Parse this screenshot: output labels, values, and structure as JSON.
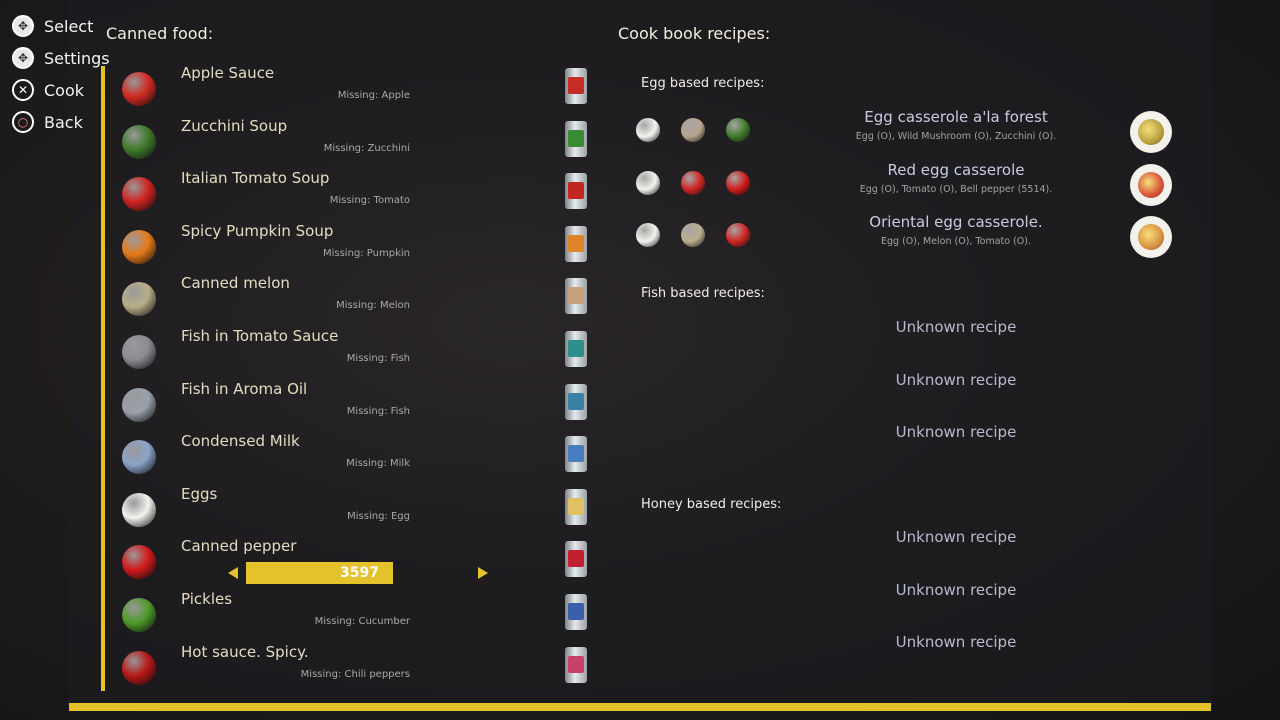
{
  "controls": [
    {
      "label": "Select",
      "glyph": "✥"
    },
    {
      "label": "Settings",
      "glyph": "✥"
    },
    {
      "label": "Cook",
      "glyph": "✕"
    },
    {
      "label": "Back",
      "glyph": "○"
    }
  ],
  "canned_title": "Canned food:",
  "cookbook_title": "Cook book recipes:",
  "foods": [
    {
      "name": "Apple Sauce",
      "missing": "Missing: Apple",
      "color": "#d22a22",
      "label_color": "#c62b24"
    },
    {
      "name": "Zucchini Soup",
      "missing": "Missing: Zucchini",
      "color": "#3f7a2a",
      "label_color": "#3a8a32"
    },
    {
      "name": "Italian Tomato Soup",
      "missing": "Missing: Tomato",
      "color": "#d02420",
      "label_color": "#c02622"
    },
    {
      "name": "Spicy Pumpkin Soup",
      "missing": "Missing: Pumpkin",
      "color": "#e57a18",
      "label_color": "#e0842a"
    },
    {
      "name": "Canned melon",
      "missing": "Missing: Melon",
      "color": "#b9ae8a",
      "label_color": "#c5a27a"
    },
    {
      "name": "Fish in Tomato Sauce",
      "missing": "Missing: Fish",
      "color": "#8a8c92",
      "label_color": "#2f8f8a"
    },
    {
      "name": "Fish in Aroma Oil",
      "missing": "Missing: Fish",
      "color": "#9aa0aa",
      "label_color": "#3a7fa4"
    },
    {
      "name": "Condensed Milk",
      "missing": "Missing: Milk",
      "color": "#8aa4c8",
      "label_color": "#4a7cc0"
    },
    {
      "name": "Eggs",
      "missing": "Missing: Egg",
      "color": "#f4f2ee",
      "label_color": "#e0c060"
    },
    {
      "name": "Canned pepper",
      "missing": "",
      "color": "#d21a1a",
      "label_color": "#c22030"
    },
    {
      "name": "Pickles",
      "missing": "Missing: Cucumber",
      "color": "#4f9a2a",
      "label_color": "#3a5ea8"
    },
    {
      "name": "Hot sauce. Spicy.",
      "missing": "Missing: Chili peppers",
      "color": "#b81818",
      "label_color": "#c8406a"
    }
  ],
  "quantity": {
    "value": "3597",
    "fill_fraction": 1.0
  },
  "sections": [
    {
      "title": "Egg based recipes:"
    },
    {
      "title": "Fish based recipes:"
    },
    {
      "title": "Honey based recipes:"
    }
  ],
  "egg_recipes": [
    {
      "name": "Egg casserole a'la forest",
      "ingredients": "Egg (O), Wild Mushroom (O), Zucchini (O).",
      "icons": [
        {
          "icon": "egg-icon",
          "color": "#f4f2ee"
        },
        {
          "icon": "mushroom-icon",
          "color": "#b7a48c"
        },
        {
          "icon": "zucchini-icon",
          "color": "#3f7a2a"
        }
      ],
      "dish_color": "#b8a040"
    },
    {
      "name": "Red egg casserole",
      "ingredients": "Egg (O), Tomato (O), Bell pepper (5514).",
      "icons": [
        {
          "icon": "egg-icon",
          "color": "#f4f2ee"
        },
        {
          "icon": "tomato-icon",
          "color": "#d02420"
        },
        {
          "icon": "bell-pepper-icon",
          "color": "#d21a1a"
        }
      ],
      "dish_color": "#d8503a"
    },
    {
      "name": "Oriental egg casserole.",
      "ingredients": "Egg (O), Melon (O), Tomato (O).",
      "icons": [
        {
          "icon": "egg-icon",
          "color": "#f4f2ee"
        },
        {
          "icon": "melon-icon",
          "color": "#b9ae8a"
        },
        {
          "icon": "tomato-icon",
          "color": "#d02420"
        }
      ],
      "dish_color": "#d99040"
    }
  ],
  "unknown_label": "Unknown recipe",
  "fish_unknown": [
    "Unknown recipe",
    "Unknown recipe",
    "Unknown recipe"
  ],
  "honey_unknown": [
    "Unknown recipe",
    "Unknown recipe",
    "Unknown recipe"
  ],
  "accent": "#e4c22c"
}
